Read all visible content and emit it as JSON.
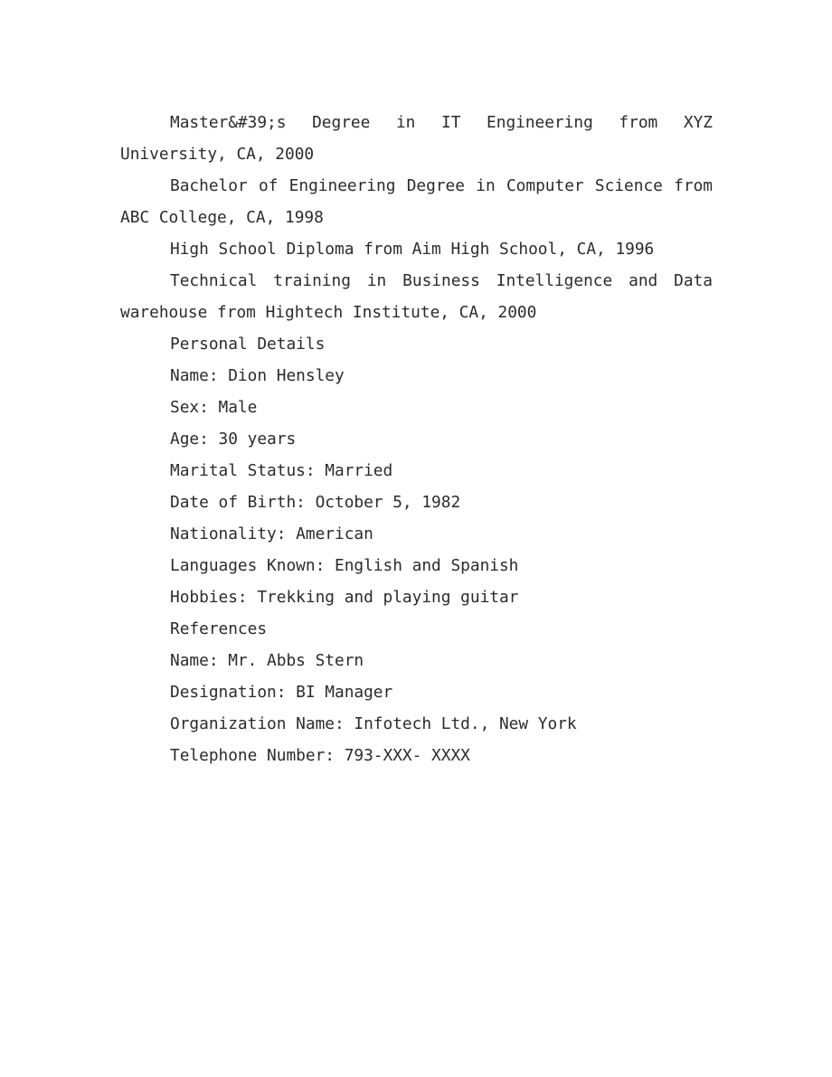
{
  "document": {
    "background_color": "#ffffff",
    "text_color": "#2b2b2b",
    "education": {
      "masters": "Master&#39;s Degree in IT Engineering from XYZ University, CA, 2000",
      "bachelor": "Bachelor of Engineering Degree in Computer Science from ABC College, CA, 1998",
      "high_school": "High School Diploma from Aim High School, CA, 1996",
      "technical_training": "Technical training in Business Intelligence and Data warehouse from Hightech Institute, CA, 2000"
    },
    "personal_details": {
      "heading": "Personal Details",
      "name": "Name: Dion Hensley",
      "sex": "Sex: Male",
      "age": "Age: 30 years",
      "marital_status": "Marital Status: Married",
      "date_of_birth": "Date of Birth: October 5, 1982",
      "nationality": "Nationality: American",
      "languages_known": "Languages Known: English and Spanish",
      "hobbies": "Hobbies: Trekking and playing guitar"
    },
    "references": {
      "heading": "References",
      "name": "Name: Mr. Abbs Stern",
      "designation": "Designation: BI Manager",
      "organization_name": "Organization Name: Infotech Ltd., New York",
      "telephone_number": "Telephone Number: 793-XXX- XXXX"
    }
  }
}
